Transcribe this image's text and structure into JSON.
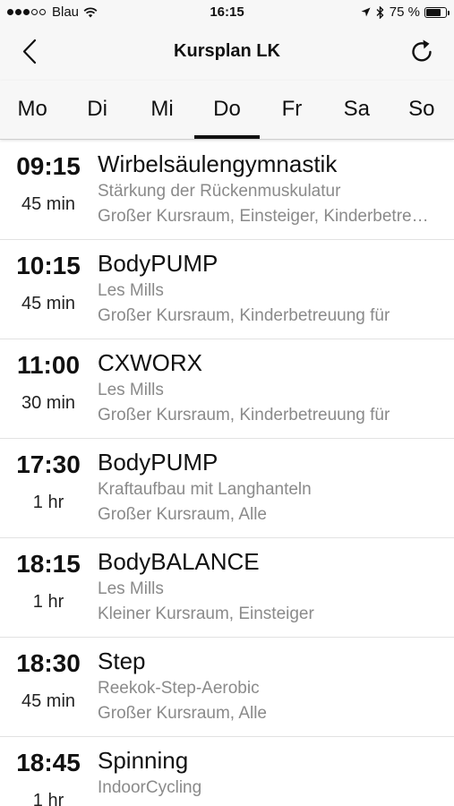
{
  "status_bar": {
    "carrier": "Blau",
    "time": "16:15",
    "battery_label": "75 %",
    "battery_level": 0.75,
    "signal_bars_filled": 3,
    "signal_bars_total": 5
  },
  "nav": {
    "title": "Kursplan LK",
    "back_icon": "chevron-left-icon",
    "refresh_icon": "refresh-icon"
  },
  "days": [
    {
      "label": "Mo",
      "active": false
    },
    {
      "label": "Di",
      "active": false
    },
    {
      "label": "Mi",
      "active": false
    },
    {
      "label": "Do",
      "active": true
    },
    {
      "label": "Fr",
      "active": false
    },
    {
      "label": "Sa",
      "active": false
    },
    {
      "label": "So",
      "active": false
    }
  ],
  "courses": [
    {
      "time": "09:15",
      "duration": "45 min",
      "title": "Wirbelsäulengymnastik",
      "subtitle": "Stärkung der Rückenmuskulatur",
      "location": "Großer Kursraum, Einsteiger, Kinderbetreuung"
    },
    {
      "time": "10:15",
      "duration": "45 min",
      "title": "BodyPUMP",
      "subtitle": "Les Mills",
      "location": "Großer Kursraum, Kinderbetreuung für"
    },
    {
      "time": "11:00",
      "duration": "30 min",
      "title": "CXWORX",
      "subtitle": "Les Mills",
      "location": "Großer Kursraum, Kinderbetreuung für"
    },
    {
      "time": "17:30",
      "duration": "1 hr",
      "title": "BodyPUMP",
      "subtitle": "Kraftaufbau mit Langhanteln",
      "location": "Großer Kursraum, Alle"
    },
    {
      "time": "18:15",
      "duration": "1 hr",
      "title": "BodyBALANCE",
      "subtitle": "Les Mills",
      "location": "Kleiner Kursraum, Einsteiger"
    },
    {
      "time": "18:30",
      "duration": "45 min",
      "title": "Step",
      "subtitle": "Reekok-Step-Aerobic",
      "location": "Großer Kursraum, Alle"
    },
    {
      "time": "18:45",
      "duration": "1 hr",
      "title": "Spinning",
      "subtitle": "IndoorCycling",
      "location": ""
    }
  ]
}
